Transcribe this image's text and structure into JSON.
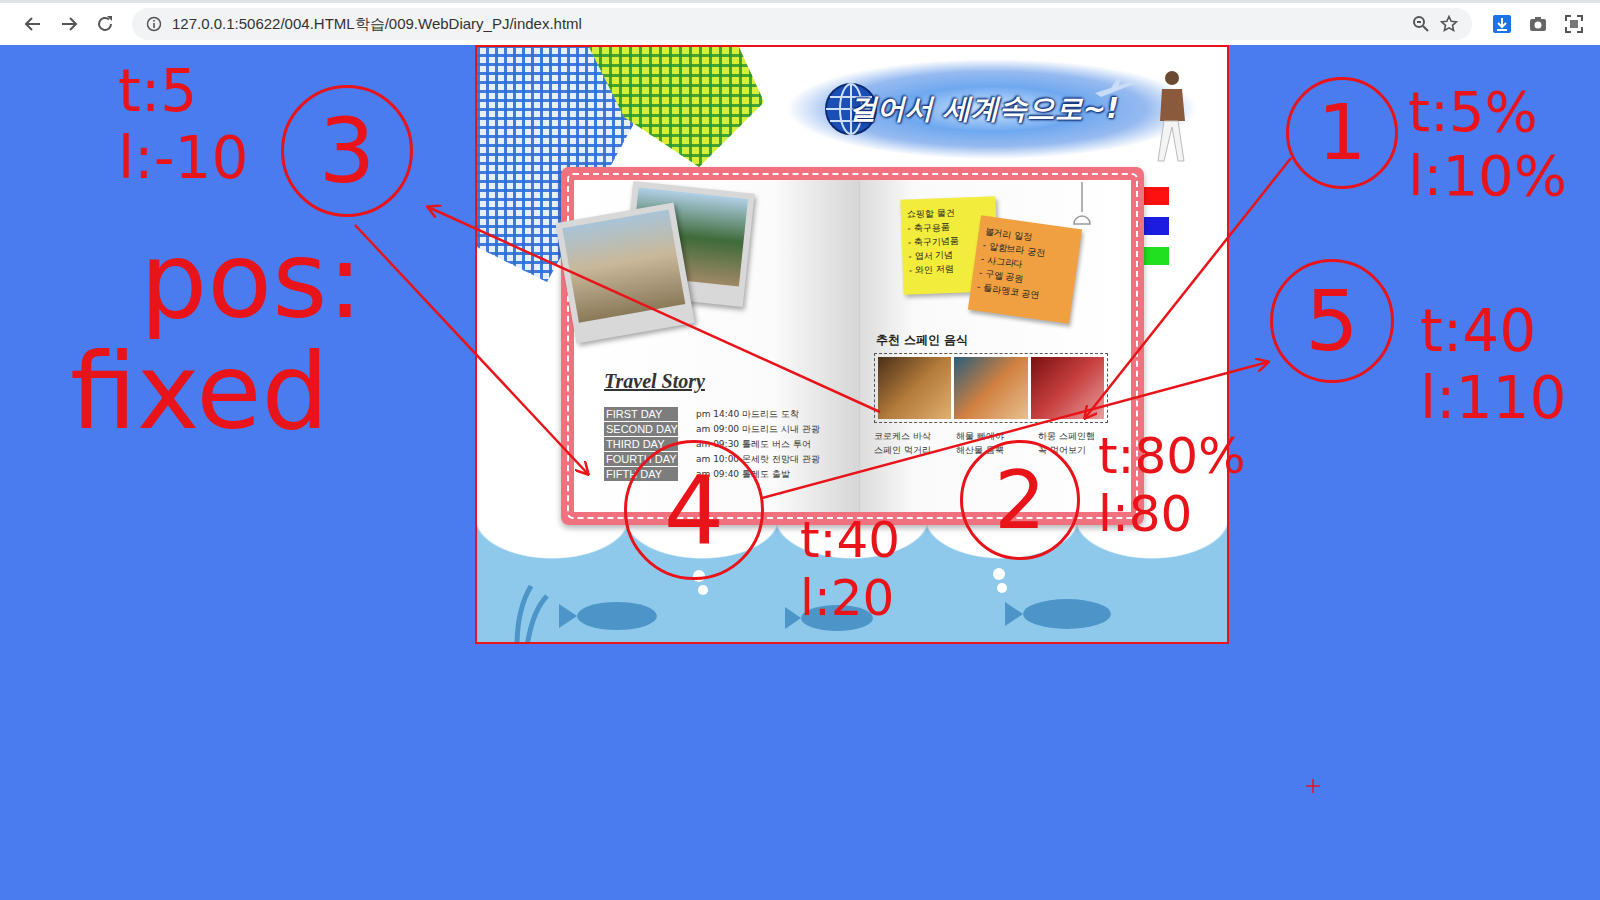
{
  "browser": {
    "url": "127.0.0.1:50622/004.HTML학습/009.WebDiary_PJ/index.html"
  },
  "diary": {
    "banner_title": "걸어서 세계속으로~!",
    "story_title": "Travel Story",
    "schedule": [
      {
        "day": "FIRST DAY",
        "plan": "pm 14:40 마드리드 도착"
      },
      {
        "day": "SECOND DAY",
        "plan": "am 09:00 마드리드 시내 관광"
      },
      {
        "day": "THIRD DAY",
        "plan": "am 09:30 톨레도 버스 투어"
      },
      {
        "day": "FOURTH DAY",
        "plan": "am 10:00 몬세랏 전망대 관광"
      },
      {
        "day": "FIFTH DAY",
        "plan": "am 09:40 톨레도 출발"
      }
    ],
    "notes": [
      {
        "lines": [
          "쇼핑할 물건",
          "- 축구용품",
          "- 축구기념품",
          "- 엽서 기념",
          "- 와인 저렴"
        ],
        "color": "#f2ec3c"
      },
      {
        "lines": [
          "볼거리 일정",
          "- 알함브라 궁전",
          "- 사그라다",
          "- 구엘 공원",
          "- 플라멩코 공연"
        ],
        "color": "#f0a040"
      }
    ],
    "food_title": "추천 스페인 음식",
    "food_captions": [
      [
        "코로케스 바삭",
        "스페인 먹거리"
      ],
      [
        "해물 빠에야",
        "해산물 듬뿍"
      ],
      [
        "하몽 스페인햄",
        "꼭 먹어보기"
      ]
    ],
    "tabs": [
      {
        "color": "#ff1010"
      },
      {
        "color": "#1c1ce0"
      },
      {
        "color": "#20e020"
      }
    ]
  },
  "annotations": {
    "marks": [
      {
        "number": "1",
        "lines": [
          "t:5%",
          "l:10%"
        ]
      },
      {
        "number": "2",
        "lines": [
          "t:80%",
          "l:80"
        ]
      },
      {
        "number": "3",
        "lines": [
          "t:5",
          "l:-10"
        ]
      },
      {
        "number": "4",
        "lines": [
          "t:40",
          "l:20"
        ]
      },
      {
        "number": "5",
        "lines": [
          "t:40",
          "l:110"
        ]
      }
    ],
    "note": [
      "pos:",
      "fixed"
    ]
  }
}
